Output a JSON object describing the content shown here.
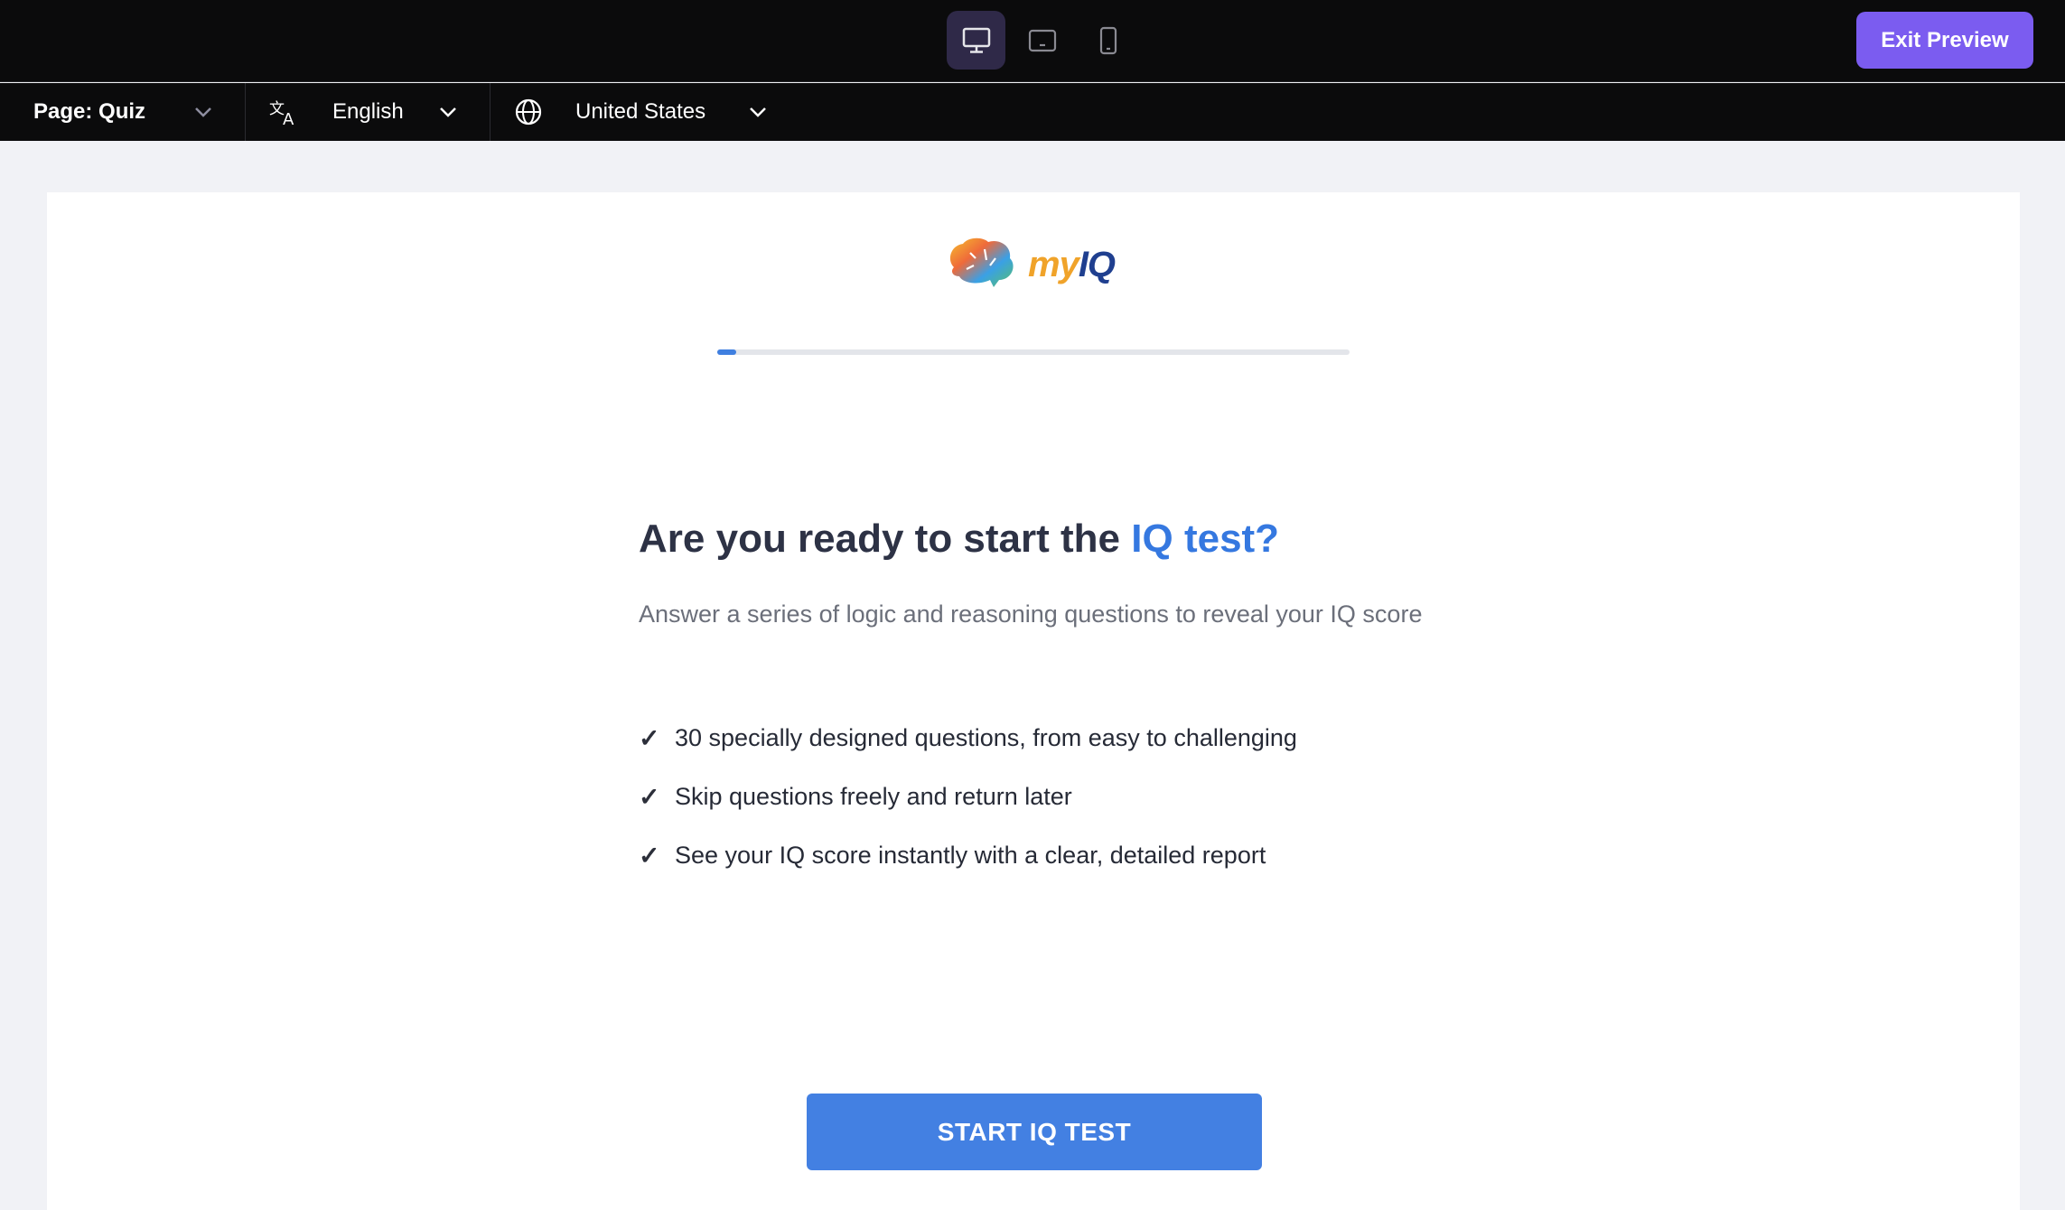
{
  "topbar": {
    "devices": [
      {
        "name": "desktop-icon",
        "active": true
      },
      {
        "name": "tablet-icon",
        "active": false
      },
      {
        "name": "mobile-icon",
        "active": false
      }
    ],
    "exit_label": "Exit Preview"
  },
  "subbar": {
    "page_label": "Page: Quiz",
    "language": "English",
    "region": "United States"
  },
  "quiz": {
    "logo": {
      "my": "my",
      "iq": "IQ"
    },
    "progress": 0.03,
    "headline_main": "Are you ready to start the ",
    "headline_accent": "IQ test?",
    "subhead": "Answer a series of logic and reasoning questions to reveal your IQ score",
    "check_glyph": "✓",
    "features": [
      "30 specially designed questions, from easy to challenging",
      "Skip questions freely and return later",
      "See your IQ score instantly with a clear, detailed report"
    ],
    "start_label": "START IQ TEST"
  },
  "colors": {
    "accent_purple": "#7b5cf0",
    "accent_blue": "#3578e0",
    "button_blue": "#4380e2"
  }
}
